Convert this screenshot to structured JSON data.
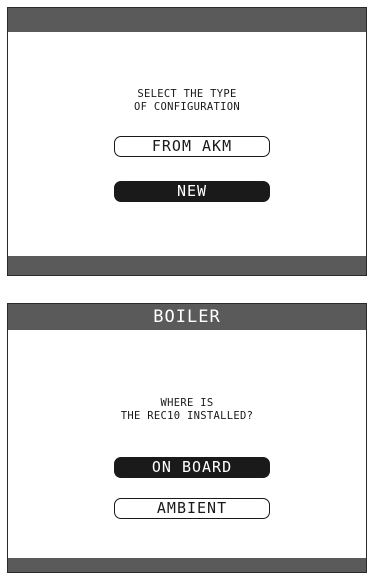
{
  "screen1": {
    "prompt_line1": "SELECT THE TYPE",
    "prompt_line2": "OF CONFIGURATION",
    "options": [
      {
        "label": "FROM AKM",
        "selected": false
      },
      {
        "label": "NEW",
        "selected": true
      }
    ]
  },
  "screen2": {
    "title": "BOILER",
    "prompt_line1": "WHERE IS",
    "prompt_line2": "THE REC10 INSTALLED?",
    "options": [
      {
        "label": "ON BOARD",
        "selected": true
      },
      {
        "label": "AMBIENT",
        "selected": false
      }
    ]
  },
  "colors": {
    "bar": "#5a5a5a",
    "frame": "#2a2a2a",
    "text": "#1a1a1a",
    "selected_bg": "#1a1a1a",
    "selected_text": "#ffffff"
  }
}
